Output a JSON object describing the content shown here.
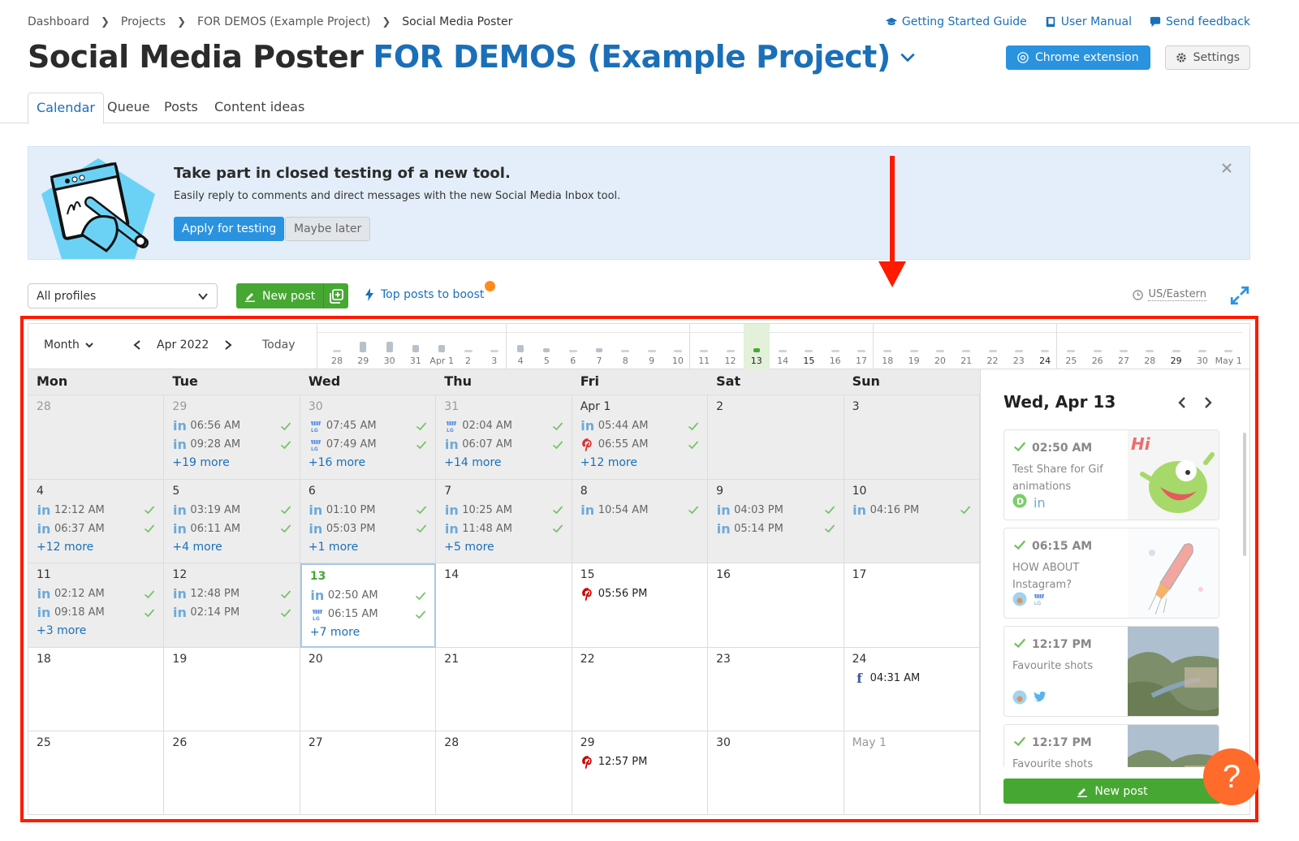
{
  "breadcrumb": [
    "Dashboard",
    "Projects",
    "FOR DEMOS (Example Project)",
    "Social Media Poster"
  ],
  "top_links": {
    "guide": "Getting Started Guide",
    "manual": "User Manual",
    "feedback": "Send feedback"
  },
  "title": {
    "tool": "Social Media Poster",
    "project": "FOR DEMOS (Example Project)"
  },
  "header_buttons": {
    "chrome": "Chrome extension",
    "settings": "Settings"
  },
  "tabs": [
    "Calendar",
    "Queue",
    "Posts",
    "Content ideas"
  ],
  "banner": {
    "title": "Take part in closed testing of a new tool.",
    "text": "Easily reply to comments and direct messages with the new Social Media Inbox tool.",
    "apply": "Apply for testing",
    "later": "Maybe later"
  },
  "toolbar": {
    "profiles": "All profiles",
    "new_post": "New post",
    "top_posts": "Top posts to boost",
    "timezone": "US/Eastern"
  },
  "calendar": {
    "view": "Month",
    "period": "Apr 2022",
    "today": "Today",
    "timeline": [
      {
        "label": "28",
        "level": 0
      },
      {
        "label": "29",
        "level": 3
      },
      {
        "label": "30",
        "level": 3
      },
      {
        "label": "31",
        "level": 2
      },
      {
        "label": "Apr 1",
        "level": 2
      },
      {
        "label": "2",
        "level": 0
      },
      {
        "label": "3",
        "level": 0
      },
      {
        "label": "4",
        "level": 2
      },
      {
        "label": "5",
        "level": 1
      },
      {
        "label": "6",
        "level": 0
      },
      {
        "label": "7",
        "level": 1
      },
      {
        "label": "8",
        "level": 0
      },
      {
        "label": "9",
        "level": 0
      },
      {
        "label": "10",
        "level": 0
      },
      {
        "label": "11",
        "level": 0
      },
      {
        "label": "12",
        "level": 0
      },
      {
        "label": "13",
        "level": 1,
        "today": true
      },
      {
        "label": "14",
        "level": 0
      },
      {
        "label": "15",
        "level": 0,
        "bold": true
      },
      {
        "label": "16",
        "level": 0
      },
      {
        "label": "17",
        "level": 0
      },
      {
        "label": "18",
        "level": 0
      },
      {
        "label": "19",
        "level": 0
      },
      {
        "label": "20",
        "level": 0
      },
      {
        "label": "21",
        "level": 0
      },
      {
        "label": "22",
        "level": 0
      },
      {
        "label": "23",
        "level": 0
      },
      {
        "label": "24",
        "level": 0,
        "bold": true
      },
      {
        "label": "25",
        "level": 0
      },
      {
        "label": "26",
        "level": 0
      },
      {
        "label": "27",
        "level": 0
      },
      {
        "label": "28",
        "level": 0
      },
      {
        "label": "29",
        "level": 0,
        "bold": true
      },
      {
        "label": "30",
        "level": 0
      },
      {
        "label": "May 1",
        "level": 0
      }
    ],
    "weekdays": [
      "Mon",
      "Tue",
      "Wed",
      "Thu",
      "Fri",
      "Sat",
      "Sun"
    ],
    "weeks": [
      [
        {
          "day": "28",
          "muted": true,
          "past": true,
          "posts": []
        },
        {
          "day": "29",
          "muted": true,
          "past": true,
          "posts": [
            {
              "net": "linkedin",
              "time": "06:56 AM",
              "done": true
            },
            {
              "net": "linkedin",
              "time": "09:28 AM",
              "done": true
            }
          ],
          "more": "+19 more"
        },
        {
          "day": "30",
          "muted": true,
          "past": true,
          "posts": [
            {
              "net": "gmb",
              "time": "07:45 AM",
              "done": true
            },
            {
              "net": "gmb",
              "time": "07:49 AM",
              "done": true
            }
          ],
          "more": "+16 more"
        },
        {
          "day": "31",
          "muted": true,
          "past": true,
          "posts": [
            {
              "net": "gmb",
              "time": "02:04 AM",
              "done": true
            },
            {
              "net": "linkedin",
              "time": "06:07 AM",
              "done": true
            }
          ],
          "more": "+14 more"
        },
        {
          "day": "Apr 1",
          "past": true,
          "posts": [
            {
              "net": "linkedin",
              "time": "05:44 AM",
              "done": true
            },
            {
              "net": "pinterest",
              "time": "06:55 AM",
              "done": true
            }
          ],
          "more": "+12 more"
        },
        {
          "day": "2",
          "past": true,
          "posts": []
        },
        {
          "day": "3",
          "past": true,
          "posts": []
        }
      ],
      [
        {
          "day": "4",
          "past": true,
          "posts": [
            {
              "net": "linkedin",
              "time": "12:12 AM",
              "done": true
            },
            {
              "net": "linkedin",
              "time": "06:37 AM",
              "done": true
            }
          ],
          "more": "+12 more"
        },
        {
          "day": "5",
          "past": true,
          "posts": [
            {
              "net": "linkedin",
              "time": "03:19 AM",
              "done": true
            },
            {
              "net": "linkedin",
              "time": "06:11 AM",
              "done": true
            }
          ],
          "more": "+4 more"
        },
        {
          "day": "6",
          "past": true,
          "posts": [
            {
              "net": "linkedin",
              "time": "01:10 PM",
              "done": true
            },
            {
              "net": "linkedin",
              "time": "05:03 PM",
              "done": true
            }
          ],
          "more": "+1 more"
        },
        {
          "day": "7",
          "past": true,
          "posts": [
            {
              "net": "linkedin",
              "time": "10:25 AM",
              "done": true
            },
            {
              "net": "linkedin",
              "time": "11:48 AM",
              "done": true
            }
          ],
          "more": "+5 more"
        },
        {
          "day": "8",
          "past": true,
          "posts": [
            {
              "net": "linkedin",
              "time": "10:54 AM",
              "done": true
            }
          ]
        },
        {
          "day": "9",
          "past": true,
          "posts": [
            {
              "net": "linkedin",
              "time": "04:03 PM",
              "done": true
            },
            {
              "net": "linkedin",
              "time": "05:14 PM",
              "done": true
            }
          ]
        },
        {
          "day": "10",
          "past": true,
          "posts": [
            {
              "net": "linkedin",
              "time": "04:16 PM",
              "done": true
            }
          ]
        }
      ],
      [
        {
          "day": "11",
          "past": true,
          "posts": [
            {
              "net": "linkedin",
              "time": "02:12 AM",
              "done": true
            },
            {
              "net": "linkedin",
              "time": "09:18 AM",
              "done": true
            }
          ],
          "more": "+3 more"
        },
        {
          "day": "12",
          "past": true,
          "posts": [
            {
              "net": "linkedin",
              "time": "12:48 PM",
              "done": true
            },
            {
              "net": "linkedin",
              "time": "02:14 PM",
              "done": true
            }
          ]
        },
        {
          "day": "13",
          "today": true,
          "selected": true,
          "posts": [
            {
              "net": "linkedin",
              "time": "02:50 AM",
              "done": true
            },
            {
              "net": "gmb",
              "time": "06:15 AM",
              "done": true
            }
          ],
          "more": "+7 more"
        },
        {
          "day": "14",
          "posts": []
        },
        {
          "day": "15",
          "posts": [
            {
              "net": "pinterest",
              "time": "05:56 PM",
              "done": false
            }
          ]
        },
        {
          "day": "16",
          "posts": []
        },
        {
          "day": "17",
          "posts": []
        }
      ],
      [
        {
          "day": "18",
          "posts": []
        },
        {
          "day": "19",
          "posts": []
        },
        {
          "day": "20",
          "posts": []
        },
        {
          "day": "21",
          "posts": []
        },
        {
          "day": "22",
          "posts": []
        },
        {
          "day": "23",
          "posts": []
        },
        {
          "day": "24",
          "posts": [
            {
              "net": "facebook",
              "time": "04:31 AM",
              "done": false
            }
          ]
        }
      ],
      [
        {
          "day": "25",
          "posts": []
        },
        {
          "day": "26",
          "posts": []
        },
        {
          "day": "27",
          "posts": []
        },
        {
          "day": "28",
          "posts": []
        },
        {
          "day": "29",
          "posts": [
            {
              "net": "pinterest",
              "time": "12:57 PM",
              "done": false
            }
          ]
        },
        {
          "day": "30",
          "posts": []
        },
        {
          "day": "May 1",
          "muted": true,
          "posts": []
        }
      ]
    ]
  },
  "side_panel": {
    "date": "Wed, Apr 13",
    "posts": [
      {
        "time": "02:50 AM",
        "text": "Test Share for Gif animations",
        "networks": [
          "avatar-d",
          "linkedin"
        ],
        "thumb": "monster"
      },
      {
        "time": "06:15 AM",
        "text": "HOW ABOUT Instagram?",
        "networks": [
          "avatar-photo",
          "gmb"
        ],
        "thumb": "rocket"
      },
      {
        "time": "12:17 PM",
        "text": "Favourite shots",
        "networks": [
          "avatar-photo",
          "twitter"
        ],
        "thumb": "landscape"
      },
      {
        "time": "12:17 PM",
        "text": "Favourite shots",
        "networks": [],
        "thumb": "landscape"
      }
    ],
    "new_post": "New post"
  },
  "help": "?",
  "colors": {
    "accent": "#1a6fb8",
    "green": "#46a832",
    "primary_btn": "#2a93e0",
    "highlight": "#ff1a00",
    "help": "#ff6b2b"
  }
}
